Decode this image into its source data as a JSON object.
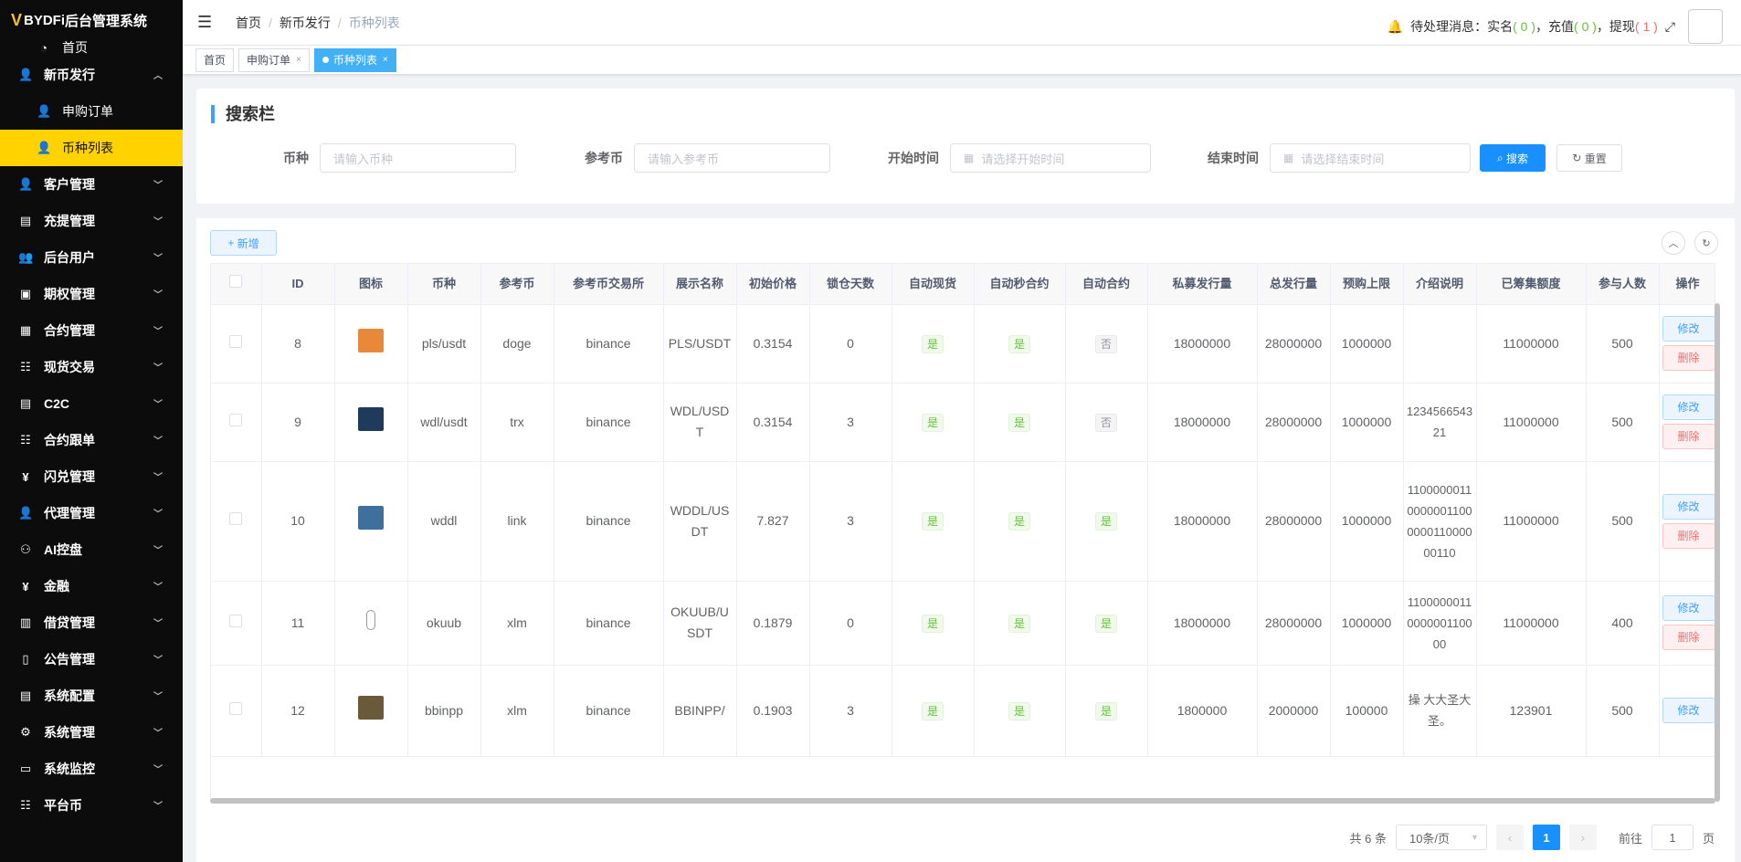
{
  "app": {
    "logo_text": "BYDFi",
    "title": "后台管理系统"
  },
  "sidebar": {
    "home": "首页",
    "items": [
      {
        "label": "新币发行",
        "icon": "user-icon",
        "expanded": true
      },
      {
        "label": "申购订单",
        "icon": "user-icon",
        "sub": true
      },
      {
        "label": "币种列表",
        "icon": "user-icon",
        "sub": true,
        "active": true
      },
      {
        "label": "客户管理",
        "icon": "user-icon"
      },
      {
        "label": "充提管理",
        "icon": "document-icon"
      },
      {
        "label": "后台用户",
        "icon": "users-icon"
      },
      {
        "label": "期权管理",
        "icon": "chart-icon"
      },
      {
        "label": "合约管理",
        "icon": "grid-icon"
      },
      {
        "label": "现货交易",
        "icon": "list-icon"
      },
      {
        "label": "C2C",
        "icon": "document-icon"
      },
      {
        "label": "合约跟单",
        "icon": "list-icon"
      },
      {
        "label": "闪兑管理",
        "icon": "yen-icon"
      },
      {
        "label": "代理管理",
        "icon": "user-icon"
      },
      {
        "label": "AI控盘",
        "icon": "robot-icon"
      },
      {
        "label": "金融",
        "icon": "yen-icon"
      },
      {
        "label": "借贷管理",
        "icon": "book-icon"
      },
      {
        "label": "公告管理",
        "icon": "book-open-icon"
      },
      {
        "label": "系统配置",
        "icon": "document-icon"
      },
      {
        "label": "系统管理",
        "icon": "gear-icon"
      },
      {
        "label": "系统监控",
        "icon": "monitor-icon"
      },
      {
        "label": "平台币",
        "icon": "list-icon"
      }
    ]
  },
  "header": {
    "breadcrumb": [
      "首页",
      "新币发行",
      "币种列表"
    ],
    "pending_label": "待处理消息：",
    "realname_label": "实名",
    "realname_count": "( 0 )",
    "recharge_label": "充值",
    "recharge_count": "( 0 )",
    "withdraw_label": "提现",
    "withdraw_count": "( 1 )"
  },
  "tags": [
    "首页",
    "申购订单",
    "币种列表"
  ],
  "search": {
    "title": "搜索栏",
    "coin_label": "币种",
    "coin_placeholder": "请输入币种",
    "ref_label": "参考币",
    "ref_placeholder": "请输入参考币",
    "start_label": "开始时间",
    "start_placeholder": "请选择开始时间",
    "end_label": "结束时间",
    "end_placeholder": "请选择结束时间",
    "search_btn": "搜索",
    "reset_btn": "重置"
  },
  "table": {
    "add_btn": "新增",
    "columns": [
      "ID",
      "图标",
      "币种",
      "参考币",
      "参考币交易所",
      "展示名称",
      "初始价格",
      "锁仓天数",
      "自动现货",
      "自动秒合约",
      "自动合约",
      "私募发行量",
      "总发行量",
      "预购上限",
      "介绍说明",
      "已筹集额度",
      "参与人数",
      "操作"
    ],
    "edit_label": "修改",
    "delete_label": "删除",
    "yes": "是",
    "no": "否",
    "rows": [
      {
        "id": "8",
        "coin": "pls/usdt",
        "ref": "doge",
        "exchange": "binance",
        "display": "PLS/USDT",
        "price": "0.3154",
        "lock": "0",
        "spot": true,
        "sec": true,
        "contract": false,
        "private": "18000000",
        "total": "28000000",
        "limit": "1000000",
        "intro": "",
        "raised": "11000000",
        "people": "500",
        "icon_color": "#e8893a"
      },
      {
        "id": "9",
        "coin": "wdl/usdt",
        "ref": "trx",
        "exchange": "binance",
        "display": "WDL/USDT",
        "price": "0.3154",
        "lock": "3",
        "spot": true,
        "sec": true,
        "contract": false,
        "private": "18000000",
        "total": "28000000",
        "limit": "1000000",
        "intro": "123456654321",
        "raised": "11000000",
        "people": "500",
        "icon_color": "#1f3b5c"
      },
      {
        "id": "10",
        "coin": "wddl",
        "ref": "link",
        "exchange": "binance",
        "display": "WDDL/USDT",
        "price": "7.827",
        "lock": "3",
        "spot": true,
        "sec": true,
        "contract": true,
        "private": "18000000",
        "total": "28000000",
        "limit": "1000000",
        "intro": "11000000110000001100000011000000110",
        "raised": "11000000",
        "people": "500",
        "icon_color": "#3f6f9c"
      },
      {
        "id": "11",
        "coin": "okuub",
        "ref": "xlm",
        "exchange": "binance",
        "display": "OKUUB/USDT",
        "price": "0.1879",
        "lock": "0",
        "spot": true,
        "sec": true,
        "contract": true,
        "private": "18000000",
        "total": "28000000",
        "limit": "1000000",
        "intro": "1100000011000000110000",
        "raised": "11000000",
        "people": "400",
        "icon_color": "#ffffff"
      },
      {
        "id": "12",
        "coin": "bbinpp",
        "ref": "xlm",
        "exchange": "binance",
        "display": "BBINPP/",
        "price": "0.1903",
        "lock": "3",
        "spot": true,
        "sec": true,
        "contract": true,
        "private": "1800000",
        "total": "2000000",
        "limit": "100000",
        "intro": "操 大大圣大圣。",
        "raised": "123901",
        "people": "500",
        "icon_color": "#6b5a3a"
      }
    ]
  },
  "pager": {
    "total": "共 6 条",
    "size": "10条/页",
    "page": "1",
    "goto_label": "前往",
    "goto_value": "1",
    "page_unit": "页"
  }
}
